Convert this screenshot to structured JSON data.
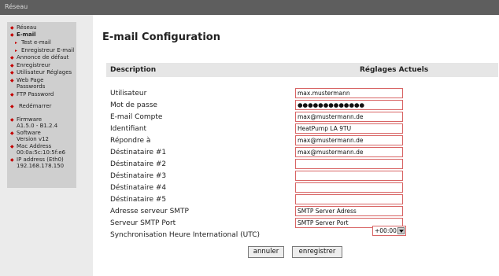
{
  "header": {
    "title": "Réseau"
  },
  "sidebar": {
    "items": [
      {
        "label": "Réseau",
        "sub": false,
        "bold": false
      },
      {
        "label": "E-mail",
        "sub": false,
        "bold": true
      },
      {
        "label": "Test e-mail",
        "sub": true,
        "bold": false
      },
      {
        "label": "Enregistreur E-mail",
        "sub": true,
        "bold": false
      },
      {
        "label": "Annonce de défaut",
        "sub": false,
        "bold": false
      },
      {
        "label": "Enregistreur",
        "sub": false,
        "bold": false
      },
      {
        "label": "Utilisateur Réglages",
        "sub": false,
        "bold": false
      },
      {
        "label": "Web Page",
        "sub": false,
        "bold": false,
        "line2": "Passwords"
      },
      {
        "label": "FTP Password",
        "sub": false,
        "bold": false
      },
      {
        "label": "Redémarrer",
        "sub": false,
        "bold": false
      },
      {
        "label": "Firmware",
        "sub": false,
        "bold": false,
        "line2": "A1.5.0 - B1.2.4"
      },
      {
        "label": "Software",
        "sub": false,
        "bold": false,
        "line2": "Version v12"
      },
      {
        "label": "Mac Address",
        "sub": false,
        "bold": false,
        "line2": "00:0a:5c:10:5f:e6"
      },
      {
        "label": "IP address (Eth0)",
        "sub": false,
        "bold": false,
        "line2": "192.168.178.150"
      }
    ]
  },
  "main": {
    "title": "E-mail Configuration",
    "col_description": "Description",
    "col_settings": "Réglages Actuels"
  },
  "form": {
    "fields": [
      {
        "label": "Utilisateur",
        "value": "max.mustermann"
      },
      {
        "label": "Mot de passe",
        "value": "●●●●●●●●●●●●●"
      },
      {
        "label": "E-mail Compte",
        "value": "max@mustermann.de"
      },
      {
        "label": "Identifiant",
        "value": "HeatPump LA 9TU"
      },
      {
        "label": "Répondre à",
        "value": "max@mustermann.de"
      },
      {
        "label": "Déstinataire #1",
        "value": "max@mustermann.de"
      },
      {
        "label": "Déstinataire #2",
        "value": ""
      },
      {
        "label": "Déstinataire #3",
        "value": ""
      },
      {
        "label": "Déstinataire #4",
        "value": ""
      },
      {
        "label": "Déstinataire #5",
        "value": ""
      },
      {
        "label": "Adresse serveur SMTP",
        "value": "SMTP Server Adress"
      },
      {
        "label": "Serveur SMTP Port",
        "value": "SMTP Server Port"
      }
    ],
    "timezone": {
      "label": "Synchronisation Heure International (UTC)",
      "value": "+00:00"
    }
  },
  "buttons": {
    "cancel": "annuler",
    "save": "enregistrer"
  },
  "colors": {
    "topbar": "#5e5e5e",
    "sidebar": "#cfcfcf",
    "bullet": "#c40000",
    "field_border": "#d86565"
  }
}
